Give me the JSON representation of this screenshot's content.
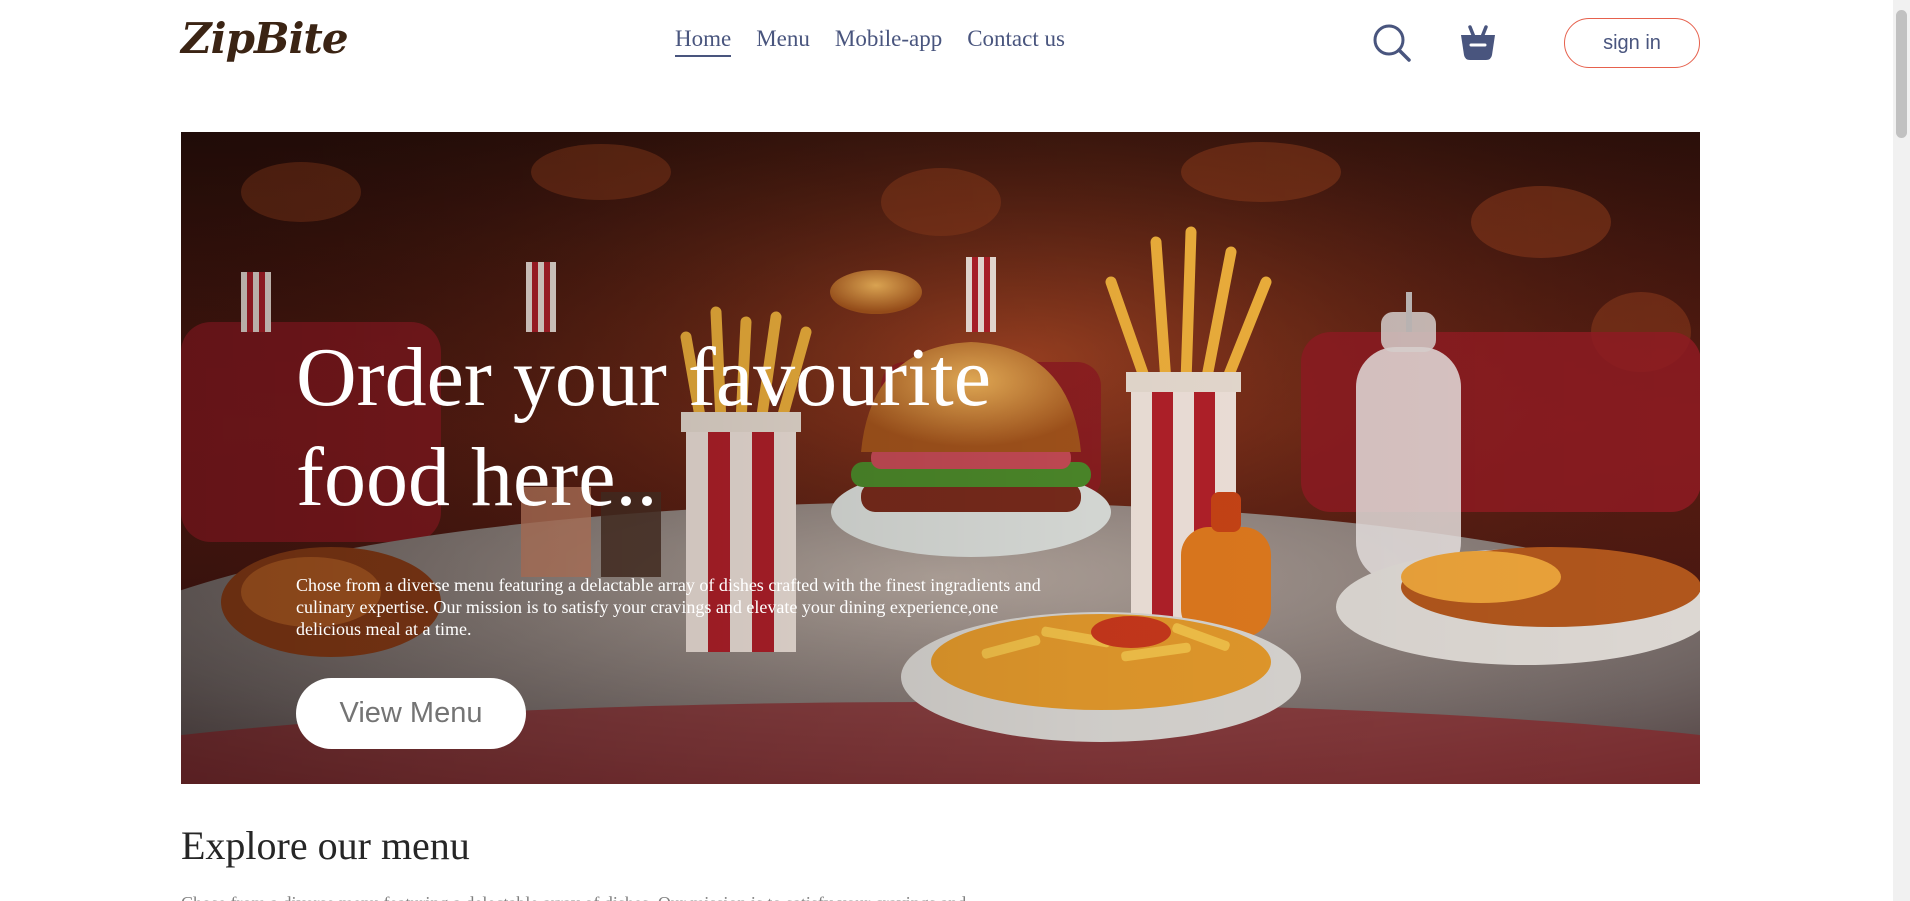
{
  "navbar": {
    "logo": "ZipBite",
    "menu": [
      {
        "label": "Home",
        "active": true
      },
      {
        "label": "Menu",
        "active": false
      },
      {
        "label": "Mobile-app",
        "active": false
      },
      {
        "label": "Contact us",
        "active": false
      }
    ],
    "search_icon": "search-icon",
    "basket_icon": "basket-icon",
    "signin_label": "sign in"
  },
  "hero": {
    "title_line1": "Order your favourite",
    "title_line2": "food here..",
    "text": "Chose from a diverse menu featuring a delactable array of dishes crafted with the finest ingradients and culinary expertise. Our mission is to satisfy your cravings and elevate your dining experience,one delicious meal at a time.",
    "button_label": "View Menu"
  },
  "explore": {
    "title": "Explore our menu",
    "text": "Chose from a diverse menu featuring a delectable array of dishes. Our mission is to satisfy your cravings and"
  },
  "colors": {
    "nav_text": "#49557e",
    "accent": "#e6614d",
    "logo": "#3b2414"
  }
}
